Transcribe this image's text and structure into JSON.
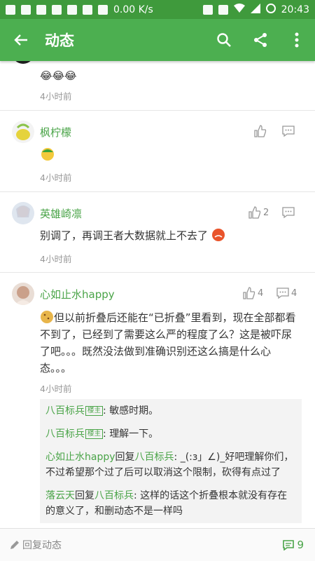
{
  "status_bar": {
    "network_speed": "0.00 K/s",
    "time": "20:43"
  },
  "app_bar": {
    "title": "动态"
  },
  "comments": [
    {
      "body": "😂😂😂",
      "time": "4小时前"
    },
    {
      "user": "枫柠檬",
      "time": "4小时前"
    },
    {
      "user": "英雄崎凛",
      "body": "别调了，再调王者大数据就上不去了",
      "time": "4小时前",
      "likes": "2"
    },
    {
      "user": "心如止水happy",
      "body": "但以前折叠后还能在“已折叠”里看到，现在全部都看不到了，已经到了需要这么严的程度了么？这是被吓尿了吧。。。既然没法做到准确识别还这么搞是什么心态。。。",
      "time": "4小时前",
      "likes": "4",
      "replies_count": "4",
      "sub_replies": [
        {
          "user": "八百标兵",
          "tag": "楼主",
          "sep": ": ",
          "text": "敏感时期。"
        },
        {
          "user": "八百标兵",
          "tag": "楼主",
          "sep": ": ",
          "text": "理解一下。"
        },
        {
          "user": "心如止水happy",
          "reply_word": "回复",
          "target": "八百标兵",
          "sep": ": ",
          "text": "_(:з」∠)_好吧理解你们，不过希望那个过了后可以取消这个限制，砍得有点过了"
        },
        {
          "user": "落云天",
          "reply_word": "回复",
          "target": "八百标兵",
          "sep": ": ",
          "text": "这样的话这个折叠根本就没有存在的意义了，和删动态不是一样吗"
        }
      ]
    }
  ],
  "bottom_bar": {
    "reply_label": "回复动态",
    "comment_count": "9"
  }
}
